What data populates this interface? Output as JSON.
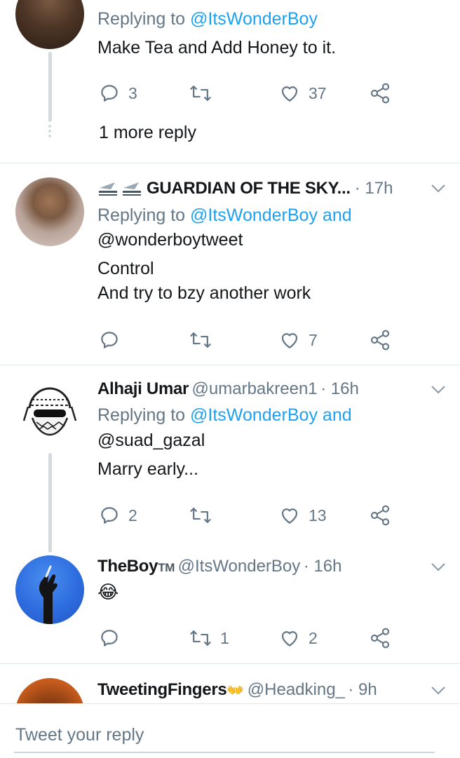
{
  "tweets": [
    {
      "replying_to": [
        "@ItsWonderBoy"
      ],
      "text": [
        "Make Tea and Add Honey to it."
      ],
      "replies": "3",
      "retweets": "",
      "likes": "37",
      "more_replies": "1 more reply"
    },
    {
      "name": "GUARDIAN OF THE SKY...",
      "time": "· 17h",
      "replying_to": [
        "@ItsWonderBoy and",
        "@wonderboytweet"
      ],
      "text": [
        "Control",
        "And try to bzy another work"
      ],
      "replies": "",
      "retweets": "",
      "likes": "7"
    },
    {
      "name": "Alhaji Umar",
      "handle": "@umarbakreen1",
      "time": "· 16h",
      "replying_to": [
        "@ItsWonderBoy and",
        "@suad_gazal"
      ],
      "text": [
        "Marry early..."
      ],
      "replies": "2",
      "retweets": "",
      "likes": "13"
    },
    {
      "name": "TheBoy",
      "name_suffix": "TM",
      "handle": "@ItsWonderBoy",
      "time": "· 16h",
      "text": [
        "😂"
      ],
      "replies": "",
      "retweets": "1",
      "likes": "2"
    },
    {
      "name": "TweetingFingers",
      "name_emoji": "👐",
      "handle": "@Headking_",
      "time": "· 9h"
    }
  ],
  "replying_prefix": "Replying to",
  "reply_box": {
    "placeholder": "Tweet your reply"
  },
  "colors": {
    "link": "#1da1f2",
    "icon": "#657786",
    "thread_line": "#d4dbe0"
  }
}
